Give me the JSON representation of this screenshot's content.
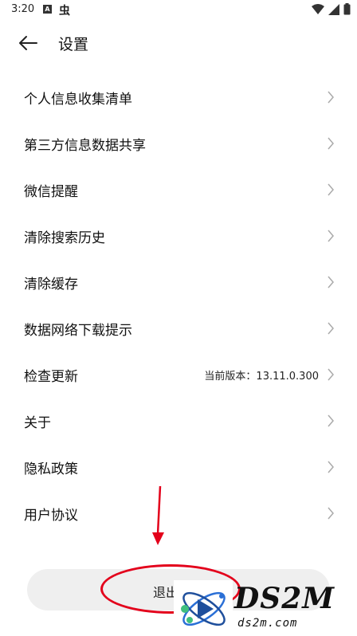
{
  "status_bar": {
    "time": "3:20",
    "notif_a": "A",
    "notif_bug": "虫"
  },
  "header": {
    "title": "设置"
  },
  "menu": {
    "items": [
      {
        "label": "个人信息收集清单"
      },
      {
        "label": "第三方信息数据共享"
      },
      {
        "label": "微信提醒"
      },
      {
        "label": "清除搜索历史"
      },
      {
        "label": "清除缓存"
      },
      {
        "label": "数据网络下载提示"
      },
      {
        "label": "检查更新",
        "value": "当前版本：13.11.0.300"
      },
      {
        "label": "关于"
      },
      {
        "label": "隐私政策"
      },
      {
        "label": "用户协议"
      }
    ]
  },
  "logout": {
    "label": "退出"
  },
  "watermark": {
    "brand": "DS2M",
    "url": "ds2m.com"
  },
  "colors": {
    "annotation_red": "#e3001b",
    "button_bg": "#efefef"
  }
}
